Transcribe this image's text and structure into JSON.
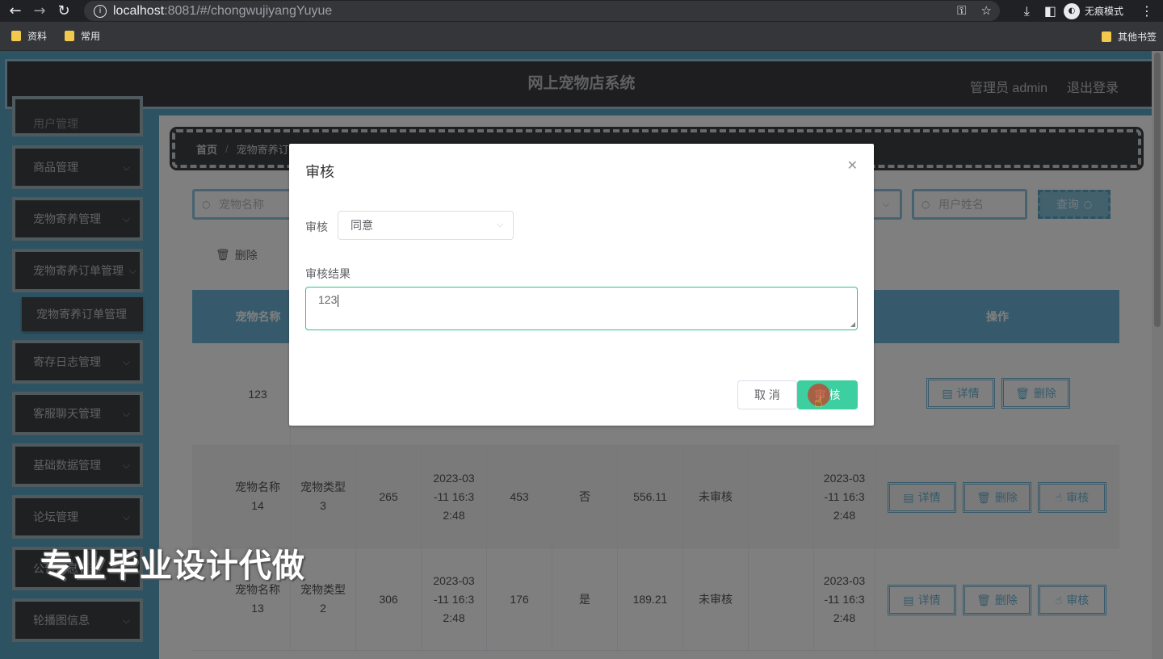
{
  "browser": {
    "url_host": "localhost",
    "url_rest": ":8081/#/chongwujiyangYuyue",
    "incognito_label": "无痕模式",
    "bookmarks": [
      "资料",
      "常用"
    ],
    "bookmarks_right": "其他书签"
  },
  "header": {
    "title": "网上宠物店系统",
    "admin": "管理员 admin",
    "logout": "退出登录"
  },
  "sidebar": {
    "partial_item": "用户管理",
    "items": [
      "商品管理",
      "宠物寄养管理",
      "宠物寄养订单管理",
      "寄存日志管理",
      "客服聊天管理",
      "基础数据管理",
      "论坛管理",
      "公告信息管理",
      "轮播图信息"
    ],
    "submenu": "宠物寄养订单管理"
  },
  "breadcrumb": {
    "home": "首页",
    "current": "宠物寄养订"
  },
  "search": {
    "pet_name_placeholder": "宠物名称",
    "user_name_placeholder": "用户姓名",
    "query_label": "查询"
  },
  "toolbar": {
    "delete_label": "删除"
  },
  "table": {
    "headers": {
      "pet_name": "宠物名称",
      "actions": "操作"
    },
    "rows": [
      {
        "pet_name": "123"
      },
      {
        "pet_name": "宠物名称\n14",
        "pet_type": "宠物类型\n3",
        "c3": "265",
        "time1": "2023-03\n-11 16:3\n2:48",
        "c5": "453",
        "yes_no": "否",
        "price": "556.11",
        "status": "未审核",
        "time2": "2023-03\n-11 16:3\n2:48"
      },
      {
        "pet_name": "宠物名称\n13",
        "pet_type": "宠物类型\n2",
        "c3": "306",
        "time1": "2023-03\n-11 16:3\n2:48",
        "c5": "176",
        "yes_no": "是",
        "price": "189.21",
        "status": "未审核",
        "time2": "2023-03\n-11 16:3\n2:48"
      }
    ],
    "btn_detail": "详情",
    "btn_delete": "删除",
    "btn_review": "审核"
  },
  "dialog": {
    "title": "审核",
    "review_label": "审核",
    "review_value": "同意",
    "result_label": "审核结果",
    "result_value": "123",
    "cancel": "取 消",
    "confirm": "审 核"
  },
  "watermark": "专业毕业设计代做"
}
